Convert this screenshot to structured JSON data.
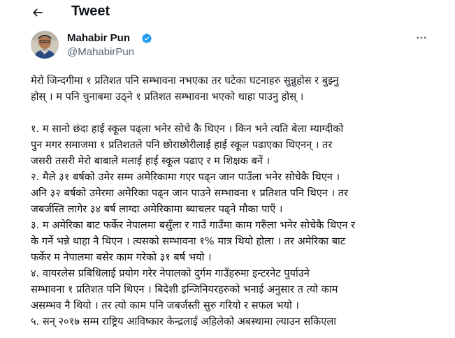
{
  "header": {
    "back_icon": "arrow-left-icon",
    "title": "Tweet"
  },
  "author": {
    "name": "Mahabir Pun",
    "handle": "@MahabirPun",
    "verified": true,
    "verified_color": "#1d9bf0"
  },
  "more_icon": "more-horizontal-icon",
  "tweet": {
    "lines": [
      "मेरो जिन्दगीमा १ प्रतिशत पनि सम्भावना नभएका तर घटेका घटनाहरु सुन्नुहोस र बुझ्नु",
      "होस् । म पनि चुनाबमा उठ्ने १ प्रतिशत सम्भावना भएको थाहा पाउनु होस् ।",
      "",
      "१. म सानो छंदा हाई स्कूल पढ्ला भनेर सोचे कै थिएन । किन भने त्यति बेला म्याग्दीको",
      "पुन मगर समाजमा १ प्रतिशतले पनि छोराछोरीलाई हाई स्कूल पढाएका थिएनन् । तर",
      "जसरी तसरी मेरो बाबाले मलाई हाई स्कूल पढाए र म शिक्षक बनें ।",
      "२. मैले ३१ बर्षको उमेर सम्म अमेरिकामा गएर पढ्न जान पाउँला भनेर सोचेकै थिएन ।",
      "अनि ३२ बर्षको उमेरमा अमेरिका पढ्न जान पाउने सम्भावना १ प्रतिशत पनि थिएन । तर",
      "जबर्जस्ति लागेर ३४ बर्ष लाग्दा अमेरिकामा ब्याचलर पढ्ने मौका पाएँ ।",
      "३. म अमेरिका बाट फर्केर नेपालमा बसुँला र गाउँ गाउँमा काम गरुँला भनेर सोचेकै थिएन र",
      "के गर्ने भन्ने थाहा नै थिएन । त्यसको सम्भावना १% मात्र थियो होला । तर अमेरिका बाट",
      "फर्केर म नेपालमा बसेर काम गरेको ३१ बर्ष भयो ।",
      "४. वायरलेस प्रबिधिलाई प्रयोग गरेर नेपालको दुर्गम गाउँहरुमा इन्टरनेट पुर्याउने",
      "सम्भावना १ प्रतिशत पनि थिएन । बिदेशी इन्जिनियरहरुको भनाई अनुसार त त्यो काम",
      "असम्भव नै थियो । तर त्यो काम पनि जबर्जस्ती सुरु गरियो र सफल भयो ।",
      "५. सन् २०१७ सम्म राष्ट्रिय आविष्कार केन्द्रलाई अहिलेको अबस्थामा ल्याउन सकिएला"
    ]
  }
}
